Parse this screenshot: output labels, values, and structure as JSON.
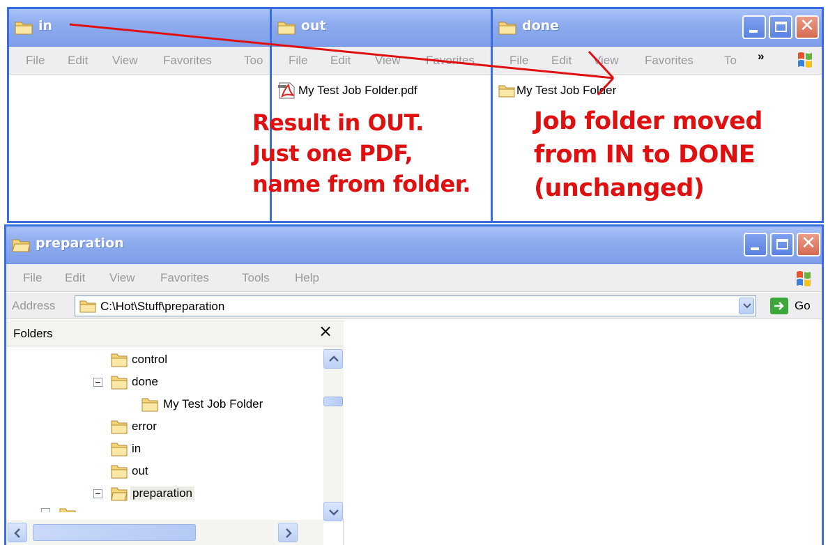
{
  "windows": {
    "in": {
      "title": "in",
      "menu": [
        "File",
        "Edit",
        "View",
        "Favorites",
        "Too"
      ]
    },
    "out": {
      "title": "out",
      "menu": [
        "File",
        "Edit",
        "View",
        "Favorites"
      ],
      "files": [
        {
          "name": "My Test Job Folder.pdf",
          "icon": "pdf-icon"
        }
      ]
    },
    "done": {
      "title": "done",
      "menu": [
        "File",
        "Edit",
        "View",
        "Favorites",
        "To",
        "»"
      ],
      "files": [
        {
          "name": "My Test Job Folder",
          "icon": "folder-icon"
        }
      ]
    },
    "preparation": {
      "title": "preparation",
      "menu": [
        "File",
        "Edit",
        "View",
        "Favorites",
        "Tools",
        "Help"
      ],
      "address_label": "Address",
      "address_value": "C:\\Hot\\Stuff\\preparation",
      "go_label": "Go",
      "folders_title": "Folders",
      "folders_close": "×",
      "tree": [
        {
          "label": "control",
          "expanded": false
        },
        {
          "label": "done",
          "expanded": true
        },
        {
          "label": "My Test Job Folder",
          "expanded": false
        },
        {
          "label": "error",
          "expanded": false
        },
        {
          "label": "in",
          "expanded": false
        },
        {
          "label": "out",
          "expanded": false
        },
        {
          "label": "preparation",
          "expanded": true,
          "selected": true
        }
      ]
    }
  },
  "annotations": {
    "out_note": "Result in OUT.\nJust one PDF,\nname from folder.",
    "done_note": "Job folder moved\nfrom IN to DONE\n(unchanged)"
  },
  "colors": {
    "annotation": "#e01010",
    "title_bar": "#8eacef",
    "window_border": "#3a6ee0"
  }
}
